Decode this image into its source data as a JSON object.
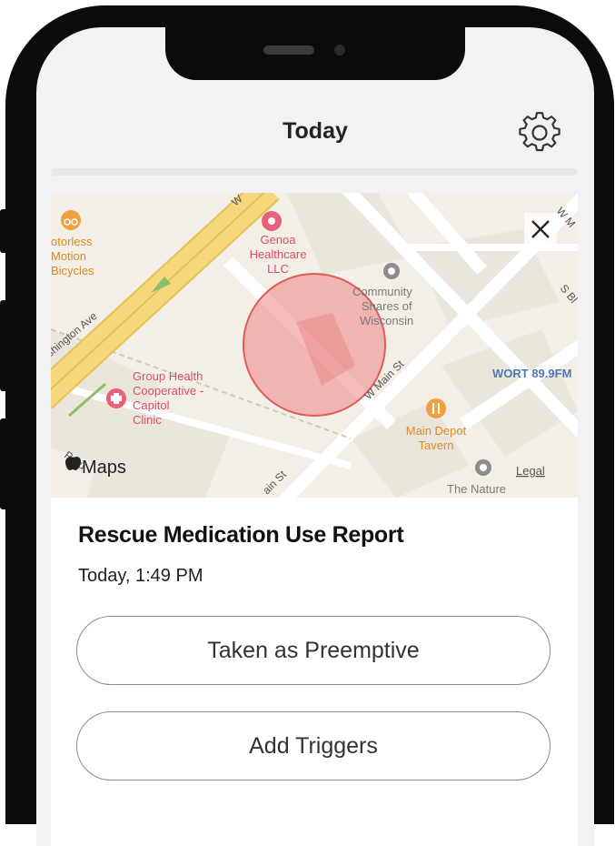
{
  "header": {
    "title": "Today",
    "settings_icon": "gear-icon"
  },
  "map": {
    "close_icon": "close-icon",
    "attribution": "Maps",
    "legal_link": "Legal",
    "streets": [
      "W",
      "ashington Ave",
      "W Main St",
      "ain St",
      "S Bl",
      "W M"
    ],
    "places": {
      "genoa": [
        "Genoa",
        "Healthcare",
        "LLC"
      ],
      "motorless": [
        "otorless",
        "Motion",
        "Bicycles"
      ],
      "community": [
        "Community",
        "Shares of",
        "Wisconsin"
      ],
      "group_health": [
        "Group Health",
        "Cooperative -",
        "Capitol",
        "Clinic"
      ],
      "wort": "WORT 89.9FM",
      "main_depot": [
        "Main Depot",
        "Tavern"
      ],
      "nature": "The Nature",
      "prou": "Prou"
    },
    "colors": {
      "pin": "#e8607a",
      "food": "#f0a040",
      "poi": "#8c8c8c",
      "location_circle": "#ef7b7b",
      "major_road": "#f6d77b"
    }
  },
  "report": {
    "title": "Rescue Medication Use Report",
    "timestamp": "Today, 1:49 PM"
  },
  "actions": {
    "preemptive_label": "Taken as Preemptive",
    "triggers_label": "Add Triggers"
  }
}
